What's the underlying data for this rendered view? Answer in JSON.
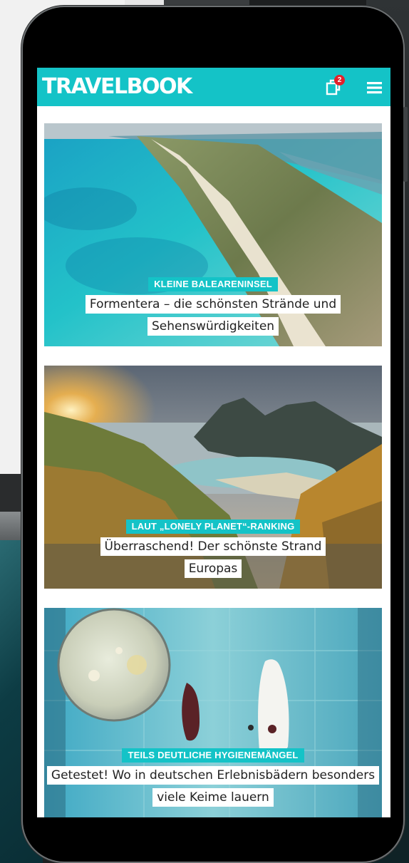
{
  "header": {
    "logo": "TRAVELBOOK",
    "notification_count": "2",
    "brand_color": "#14c3c7",
    "icons": [
      "notifications-icon",
      "menu-icon"
    ]
  },
  "articles": [
    {
      "kicker": "KLEINE BALEARENINSEL",
      "title": "Formentera – die schönsten Strände und Sehenswürdigkeiten",
      "image": "aerial-beach-photo"
    },
    {
      "kicker": "LAUT „LONELY PLANET“-RANKING",
      "title": "Überraschend! Der schönste Strand Europas",
      "image": "coast-sunset-photo"
    },
    {
      "kicker": "TEILS DEUTLICHE HYGIENEMÄNGEL",
      "title": "Getestet! Wo in deutschen Erlebnisbädern besonders viele Keime lauern",
      "image": "petri-dish-pool-photo"
    }
  ]
}
